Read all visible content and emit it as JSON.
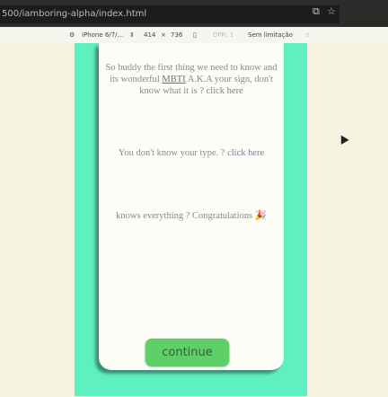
{
  "browser": {
    "url": "500/iamboring-alpha/index.html",
    "translate_icon": "translate-icon",
    "bookmark_icon": "star-icon"
  },
  "responsive_toolbar": {
    "device": "iPhone 6/7/...",
    "width": "414",
    "times": "×",
    "height": "736",
    "dpr": "DPR: 1",
    "throttle": "Sem limitação"
  },
  "page": {
    "intro_line": "So buddy the first thing we need to know and its wonderful",
    "mbti": "MBTI",
    "intro_rest": "A.K.A your sign, don't know what it is ?",
    "link1": "click here",
    "type_text": "You don't know your type. ?",
    "link2": "click here",
    "congrats": "knows everything ? Congratulations 🎉",
    "continue_label": "continue"
  },
  "colors": {
    "viewport_bg": "#5ef0c0",
    "button": "#5fcf68",
    "card": "#fbfdf6"
  }
}
